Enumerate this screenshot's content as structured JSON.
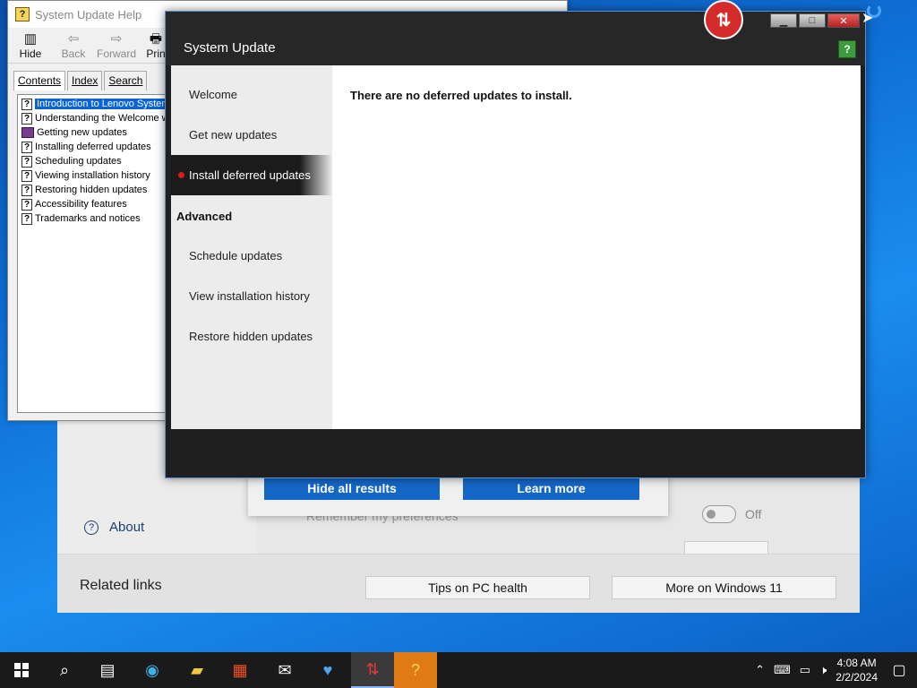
{
  "help_window": {
    "title": "System Update Help",
    "toolbar": [
      {
        "label": "Hide",
        "icon": "▥"
      },
      {
        "label": "Back",
        "icon": "⇦"
      },
      {
        "label": "Forward",
        "icon": "⇨"
      },
      {
        "label": "Prin",
        "icon": "🖶"
      }
    ],
    "tabs": [
      "Contents",
      "Index",
      "Search"
    ],
    "tree": [
      {
        "label": "Introduction to Lenovo System",
        "icon": "?"
      },
      {
        "label": "Understanding the Welcome w",
        "icon": "?"
      },
      {
        "label": "Getting new updates",
        "icon": "book"
      },
      {
        "label": "Installing deferred updates",
        "icon": "?"
      },
      {
        "label": "Scheduling updates",
        "icon": "?"
      },
      {
        "label": "Viewing installation history",
        "icon": "?"
      },
      {
        "label": "Restoring hidden updates",
        "icon": "?"
      },
      {
        "label": "Accessibility features",
        "icon": "?"
      },
      {
        "label": "Trademarks and notices",
        "icon": "?"
      }
    ]
  },
  "system_update": {
    "title": "System Update",
    "window_buttons": {
      "minimize": "▁",
      "maximize": "□",
      "close": "✕"
    },
    "help_icon": "?",
    "nav": {
      "welcome": "Welcome",
      "get_new": "Get new updates",
      "install_deferred": "Install deferred updates",
      "advanced_header": "Advanced",
      "schedule": "Schedule updates",
      "history": "View installation history",
      "restore": "Restore hidden updates"
    },
    "message": "There are no deferred updates to install."
  },
  "pc_health": {
    "about": "About",
    "about_icon": "?",
    "remember": "Remember my preferences",
    "toggle_label": "Off",
    "related_links": "Related links",
    "tips_button": "Tips on PC health",
    "more_button": "More on Windows 11",
    "hide_all": "Hide all results",
    "learn_more": "Learn more"
  },
  "taskbar": {
    "time": "4:08 AM",
    "date": "2/2/2024"
  }
}
